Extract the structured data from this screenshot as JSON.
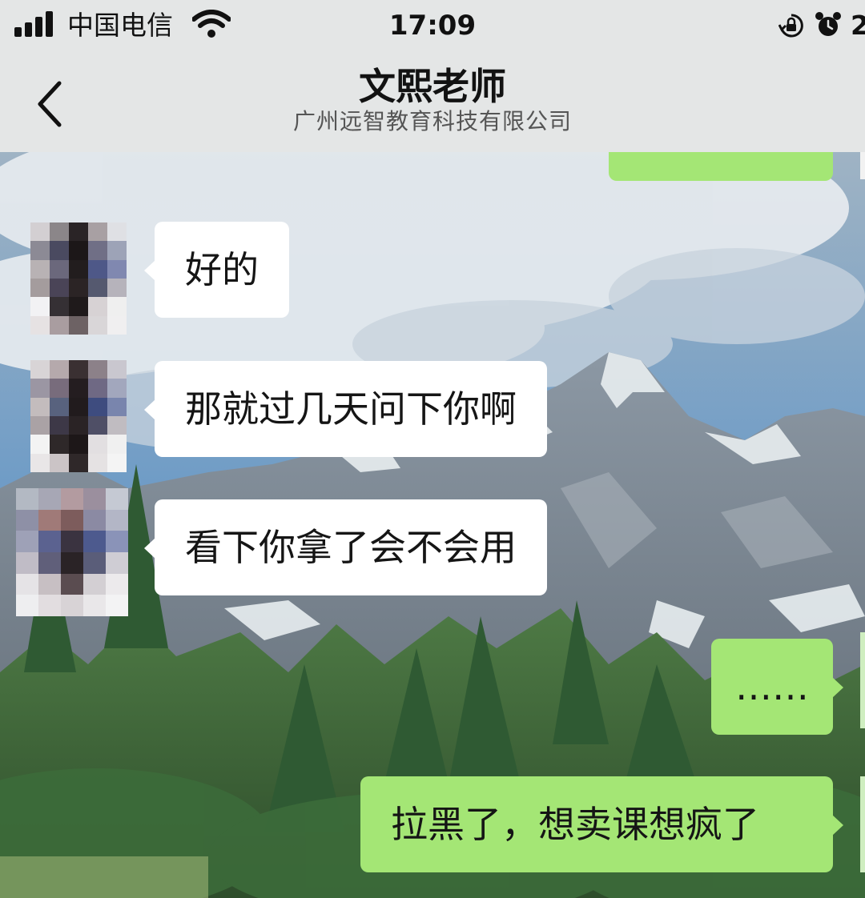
{
  "status_bar": {
    "carrier": "中国电信",
    "time": "17:09",
    "battery_partial": "2",
    "icons": [
      "signal-icon",
      "wifi-icon",
      "orientation-lock-icon",
      "alarm-icon"
    ]
  },
  "header": {
    "back_icon": "chevron-left-icon",
    "title": "文熙老师",
    "subtitle": "广州远智教育科技有限公司"
  },
  "messages": [
    {
      "side": "left",
      "text": "好的"
    },
    {
      "side": "left",
      "text": "那就过几天问下你啊"
    },
    {
      "side": "left",
      "text": "看下你拿了会不会用"
    },
    {
      "side": "right",
      "text": "……"
    },
    {
      "side": "right",
      "text": "拉黑了，想卖课想疯了"
    }
  ],
  "colors": {
    "bubble_self": "#a4e675",
    "bubble_other": "#ffffff",
    "bar_background": "#e4e6e6",
    "text": "#151515"
  }
}
